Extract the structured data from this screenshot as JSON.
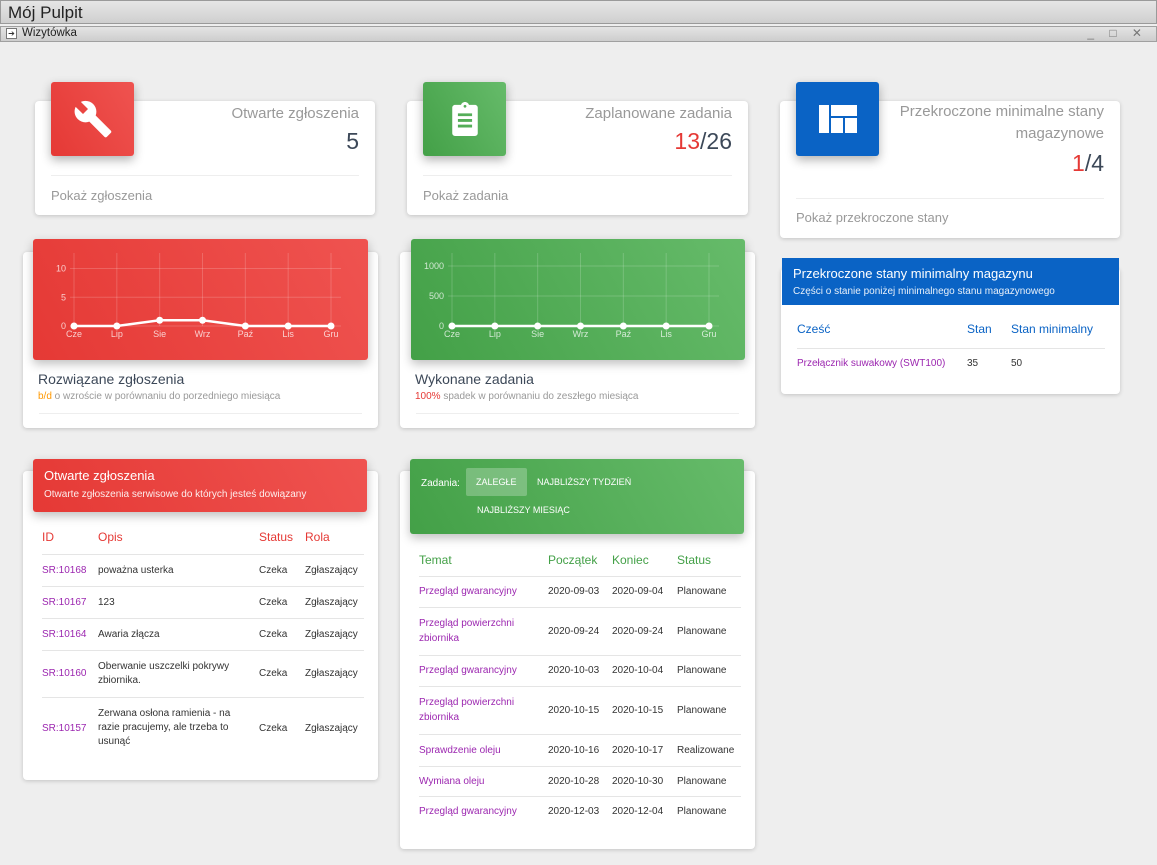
{
  "window": {
    "title": "Mój Pulpit",
    "tab": "Wizytówka",
    "controls": "_ □ ✕"
  },
  "stats": [
    {
      "title": "Otwarte zgłoszenia",
      "value_hl": "",
      "value_rest": "5",
      "link": "Pokaż zgłoszenia",
      "icon": "wrench-icon"
    },
    {
      "title": "Zaplanowane zadania",
      "value_hl": "13",
      "value_rest": "/26",
      "link": "Pokaż zadania",
      "icon": "clipboard-icon"
    },
    {
      "title": "Przekroczone minimalne stany magazynowe",
      "value_hl": "1",
      "value_rest": "/4",
      "link": "Pokaż przekroczone stany",
      "icon": "dashboard-icon"
    }
  ],
  "charts_meta": [
    {
      "title": "Rozwiązane zgłoszenia",
      "sub_hl": "b/d",
      "sub_rest": " o wzroście w porównaniu do porzedniego miesiąca"
    },
    {
      "title": "Wykonane zadania",
      "sub_hl": "100%",
      "sub_rest": " spadek w porównaniu do zeszłego miesiąca"
    }
  ],
  "chart_data": [
    {
      "type": "line",
      "categories": [
        "Cze",
        "Lip",
        "Sie",
        "Wrz",
        "Paź",
        "Lis",
        "Gru"
      ],
      "values": [
        0,
        0,
        1,
        1,
        0,
        0,
        0
      ],
      "yticks": [
        0,
        5,
        10
      ],
      "ylim": [
        0,
        12
      ],
      "grid": true,
      "color": "#e53935"
    },
    {
      "type": "line",
      "categories": [
        "Cze",
        "Lip",
        "Sie",
        "Wrz",
        "Paź",
        "Lis",
        "Gru"
      ],
      "values": [
        0,
        0,
        0,
        0,
        0,
        0,
        0
      ],
      "yticks": [
        0,
        500,
        1000
      ],
      "ylim": [
        0,
        1150
      ],
      "grid": true,
      "color": "#43a047"
    }
  ],
  "stock": {
    "header": "Przekroczone stany minimalny magazynu",
    "sub": "Części o stanie poniżej minimalnego stanu magazynowego",
    "columns": [
      "Cześć",
      "Stan",
      "Stan minimalny"
    ],
    "rows": [
      {
        "part": "Przełącznik suwakowy (SWT100)",
        "stan": "35",
        "min": "50"
      }
    ]
  },
  "tickets": {
    "header": "Otwarte zgłoszenia",
    "sub": "Otwarte zgłoszenia serwisowe do których jesteś dowiązany",
    "columns": [
      "ID",
      "Opis",
      "Status",
      "Rola"
    ],
    "rows": [
      {
        "id": "SR:10168",
        "desc": "poważna usterka",
        "status": "Czeka",
        "role": "Zgłaszający"
      },
      {
        "id": "SR:10167",
        "desc": "123",
        "status": "Czeka",
        "role": "Zgłaszający"
      },
      {
        "id": "SR:10164",
        "desc": "Awaria złącza",
        "status": "Czeka",
        "role": "Zgłaszający"
      },
      {
        "id": "SR:10160",
        "desc": "Oberwanie uszczelki pokrywy zbiornika.",
        "status": "Czeka",
        "role": "Zgłaszający"
      },
      {
        "id": "SR:10157",
        "desc": "Zerwana osłona ramienia - na razie pracujemy, ale trzeba to usunąć",
        "status": "Czeka",
        "role": "Zgłaszający"
      }
    ]
  },
  "tasks": {
    "label": "Zadania:",
    "tabs": [
      "ZALEGŁE",
      "NAJBLIŻSZY TYDZIEŃ",
      "NAJBLIŻSZY MIESIĄC"
    ],
    "columns": [
      "Temat",
      "Początek",
      "Koniec",
      "Status"
    ],
    "rows": [
      {
        "topic": "Przegląd gwarancyjny",
        "start": "2020-09-03",
        "end": "2020-09-04",
        "status": "Planowane"
      },
      {
        "topic": "Przegląd powierzchni zbiornika",
        "start": "2020-09-24",
        "end": "2020-09-24",
        "status": "Planowane"
      },
      {
        "topic": "Przegląd gwarancyjny",
        "start": "2020-10-03",
        "end": "2020-10-04",
        "status": "Planowane"
      },
      {
        "topic": "Przegląd powierzchni zbiornika",
        "start": "2020-10-15",
        "end": "2020-10-15",
        "status": "Planowane"
      },
      {
        "topic": "Sprawdzenie oleju",
        "start": "2020-10-16",
        "end": "2020-10-17",
        "status": "Realizowane"
      },
      {
        "topic": "Wymiana oleju",
        "start": "2020-10-28",
        "end": "2020-10-30",
        "status": "Planowane"
      },
      {
        "topic": "Przegląd gwarancyjny",
        "start": "2020-12-03",
        "end": "2020-12-04",
        "status": "Planowane"
      }
    ]
  }
}
